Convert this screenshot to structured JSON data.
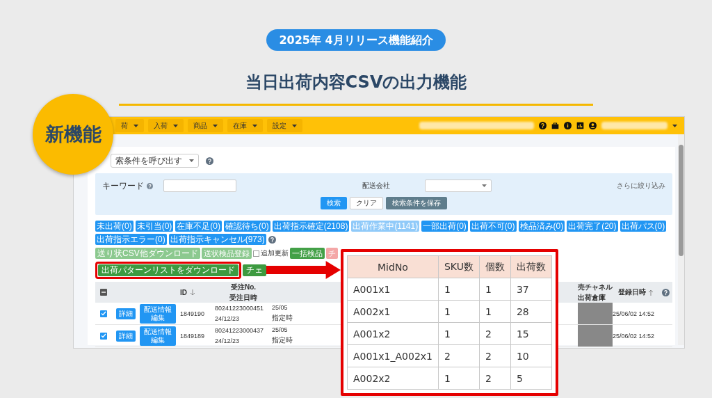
{
  "banner": "2025年 4月リリース機能紹介",
  "title": "当日出荷内容CSVの出力機能",
  "badge": "新機能",
  "app": {
    "nav": [
      {
        "label": "荷"
      },
      {
        "label": "入荷"
      },
      {
        "label": "商品"
      },
      {
        "label": "在庫"
      },
      {
        "label": "設定"
      }
    ],
    "saved_search": "索条件を呼び出す",
    "search": {
      "keyword_label": "キーワード",
      "carrier_label": "配送会社",
      "refine_link": "さらに絞り込み",
      "buttons": [
        {
          "label": "検索",
          "kind": "primary"
        },
        {
          "label": "クリア",
          "kind": "plain"
        },
        {
          "label": "検索条件を保存",
          "kind": "secondary"
        }
      ]
    },
    "status_tabs": [
      {
        "label": "未出荷(0)",
        "selected": false
      },
      {
        "label": "未引当(0)",
        "selected": false
      },
      {
        "label": "在庫不足(0)",
        "selected": false
      },
      {
        "label": "確認待ち(0)",
        "selected": false
      },
      {
        "label": "出荷指示確定(2108)",
        "selected": false
      },
      {
        "label": "出荷作業中(1141)",
        "selected": true
      },
      {
        "label": "一部出荷(0)",
        "selected": false
      },
      {
        "label": "出荷不可(0)",
        "selected": false
      },
      {
        "label": "検品済み(0)",
        "selected": false
      },
      {
        "label": "出荷完了(20)",
        "selected": false
      },
      {
        "label": "出荷パス(0)",
        "selected": false
      },
      {
        "label": "出荷指示エラー(0)",
        "selected": false
      },
      {
        "label": "出荷指示キャンセル(973)",
        "selected": false
      }
    ],
    "actions": [
      {
        "kind": "button",
        "label": "送り状CSV他ダウンロード",
        "disabled": true
      },
      {
        "kind": "button",
        "label": "送状検品登録",
        "disabled": true
      },
      {
        "kind": "checkbox",
        "label": "追加更新",
        "checked": false
      },
      {
        "kind": "button",
        "label": "一括検品",
        "disabled": false
      },
      {
        "kind": "danger",
        "label": "チ",
        "disabled": true
      }
    ],
    "download_button": "出荷パターンリストをダウンロード",
    "check_button": "チェ",
    "table": {
      "select_all": {
        "indeterminate": true
      },
      "columns": {
        "id": "ID",
        "order_no": "受注No.",
        "order_date": "受注日時",
        "channel": "売チャネル",
        "warehouse": "出荷倉庫",
        "registered": "登録日時"
      },
      "rows": [
        {
          "checked": true,
          "detail": "詳細",
          "edit": "配送情報編集",
          "id": "1849190",
          "order_no": "80241223000451",
          "order_date": "24/12/23",
          "column_6_top": "25/05",
          "column_6_bottom": "指定時",
          "registered": "25/06/02 14:52"
        },
        {
          "checked": true,
          "detail": "詳細",
          "edit": "配送情報編集",
          "id": "1849189",
          "order_no": "80241223000437",
          "order_date": "24/12/23",
          "column_6_top": "25/05",
          "column_6_bottom": "指定時",
          "registered": "25/06/02 14:52"
        }
      ]
    }
  },
  "csv_preview": {
    "columns": [
      "MidNo",
      "SKU数",
      "個数",
      "出荷数"
    ],
    "rows": [
      [
        "A001x1",
        "1",
        "1",
        "37"
      ],
      [
        "A002x1",
        "1",
        "1",
        "28"
      ],
      [
        "A001x2",
        "1",
        "2",
        "15"
      ],
      [
        "A001x1_A002x1",
        "2",
        "2",
        "10"
      ],
      [
        "A002x2",
        "1",
        "2",
        "5"
      ]
    ]
  }
}
